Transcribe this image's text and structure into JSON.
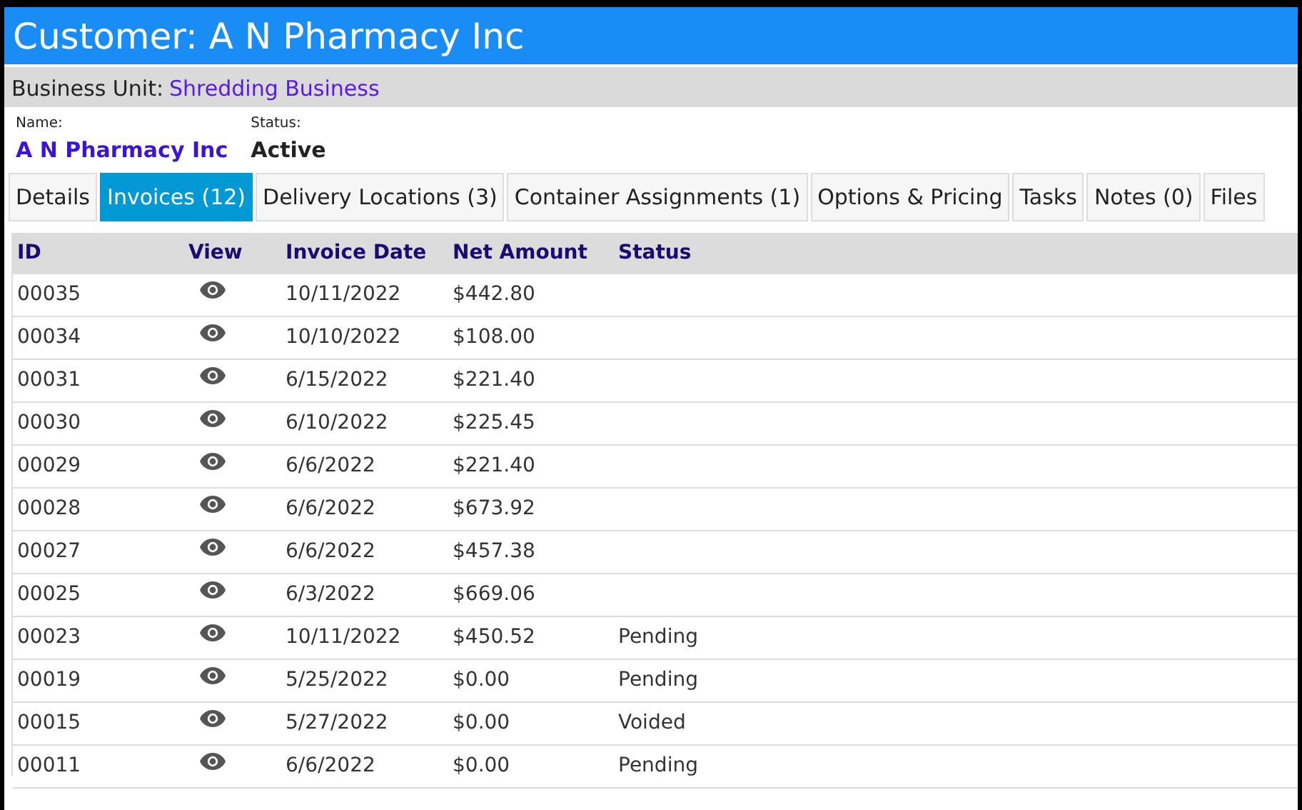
{
  "header": {
    "title": "Customer: A N Pharmacy Inc"
  },
  "business_unit": {
    "label": "Business Unit:",
    "value": "Shredding Business"
  },
  "fields": [
    {
      "label": "Name:",
      "value": "A N Pharmacy Inc",
      "kind": "link"
    },
    {
      "label": "Status:",
      "value": "Active",
      "kind": "text"
    }
  ],
  "tabs": [
    {
      "label": "Details",
      "selected": false
    },
    {
      "label": "Invoices (12)",
      "selected": true
    },
    {
      "label": "Delivery Locations (3)",
      "selected": false
    },
    {
      "label": "Container Assignments (1)",
      "selected": false
    },
    {
      "label": "Options & Pricing",
      "selected": false
    },
    {
      "label": "Tasks",
      "selected": false
    },
    {
      "label": "Notes (0)",
      "selected": false
    },
    {
      "label": "Files",
      "selected": false
    }
  ],
  "table": {
    "columns": [
      "ID",
      "View",
      "Invoice Date",
      "Net Amount",
      "Status"
    ],
    "rows": [
      {
        "id": "00035",
        "date": "10/11/2022",
        "amount": "$442.80"
      },
      {
        "id": "00034",
        "date": "10/10/2022",
        "amount": "$108.00"
      },
      {
        "id": "00031",
        "date": "6/15/2022",
        "amount": "$221.40"
      },
      {
        "id": "00030",
        "date": "6/10/2022",
        "amount": "$225.45"
      },
      {
        "id": "00029",
        "date": "6/6/2022",
        "amount": "$221.40"
      },
      {
        "id": "00028",
        "date": "6/6/2022",
        "amount": "$673.92"
      },
      {
        "id": "00027",
        "date": "6/6/2022",
        "amount": "$457.38"
      },
      {
        "id": "00025",
        "date": "6/3/2022",
        "amount": "$669.06"
      },
      {
        "id": "00023",
        "date": "10/11/2022",
        "amount": "$450.52",
        "status": "Pending"
      },
      {
        "id": "00019",
        "date": "5/25/2022",
        "amount": "$0.00",
        "status": "Pending"
      },
      {
        "id": "00015",
        "date": "5/27/2022",
        "amount": "$0.00",
        "status": "Voided"
      },
      {
        "id": "00011",
        "date": "6/6/2022",
        "amount": "$0.00",
        "status": "Pending"
      }
    ]
  }
}
